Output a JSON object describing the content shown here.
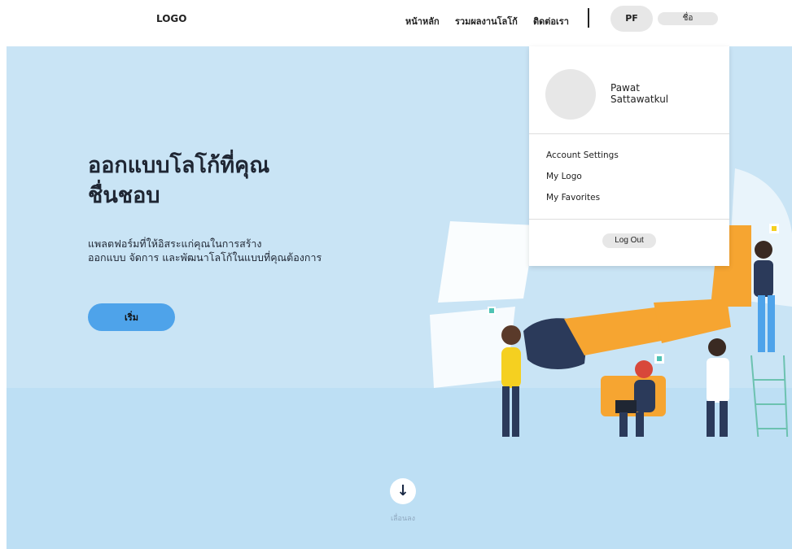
{
  "header": {
    "logo": "LOGO",
    "nav": [
      "หน้าหลัก",
      "รวมผลงานโลโก้",
      "ติดต่อเรา"
    ],
    "profile_initials": "PF",
    "name_label": "ชื่อ"
  },
  "hero": {
    "headline_line1": "ออกแบบโลโก้ที่คุณ",
    "headline_line2": "ชื่นชอบ",
    "subtitle_line1": "แพลตฟอร์มที่ให้อิสระแก่คุณในการสร้าง",
    "subtitle_line2": "ออกแบบ จัดการ และพัฒนาโลโก้ในแบบที่คุณต้องการ",
    "start_button": "เริ่ม",
    "scroll_label": "เลื่อนลง",
    "scroll_icon": "arrow-down-icon"
  },
  "dropdown": {
    "user_name_line1": "Pawat",
    "user_name_line2": "Sattawatkul",
    "items": [
      "Account Settings",
      "My Logo",
      "My Favorites"
    ],
    "logout": "Log Out"
  },
  "colors": {
    "hero_bg": "#c9e4f5",
    "accent_blue": "#4ea3ea",
    "puzzle_orange": "#f6a531",
    "navy": "#2b3a5a"
  }
}
